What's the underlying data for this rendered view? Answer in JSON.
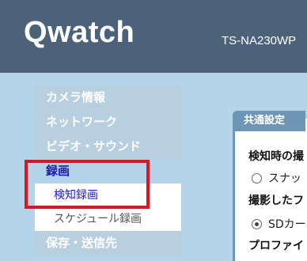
{
  "header": {
    "logo": "Qwatch",
    "model": "TS-NA230WP"
  },
  "sidebar": {
    "items": [
      {
        "label": "カメラ情報"
      },
      {
        "label": "ネットワーク"
      },
      {
        "label": "ビデオ・サウンド"
      },
      {
        "label": "録画"
      },
      {
        "label": "保存・送信先"
      }
    ],
    "sub_items": [
      {
        "label": "検知録画"
      },
      {
        "label": "スケジュール録画"
      }
    ]
  },
  "panel": {
    "tab": "共通設定",
    "field1_label": "検知時の撮",
    "field1_option": "スナッ",
    "field2_label": "撮影したフ",
    "field2_option": "SDカー",
    "field3_label": "プロファイ"
  },
  "colors": {
    "header_bg": "#4b6279",
    "page_bg": "#b3d4e9",
    "highlight_border": "#e0141e",
    "active_text": "#1a1ab0"
  }
}
